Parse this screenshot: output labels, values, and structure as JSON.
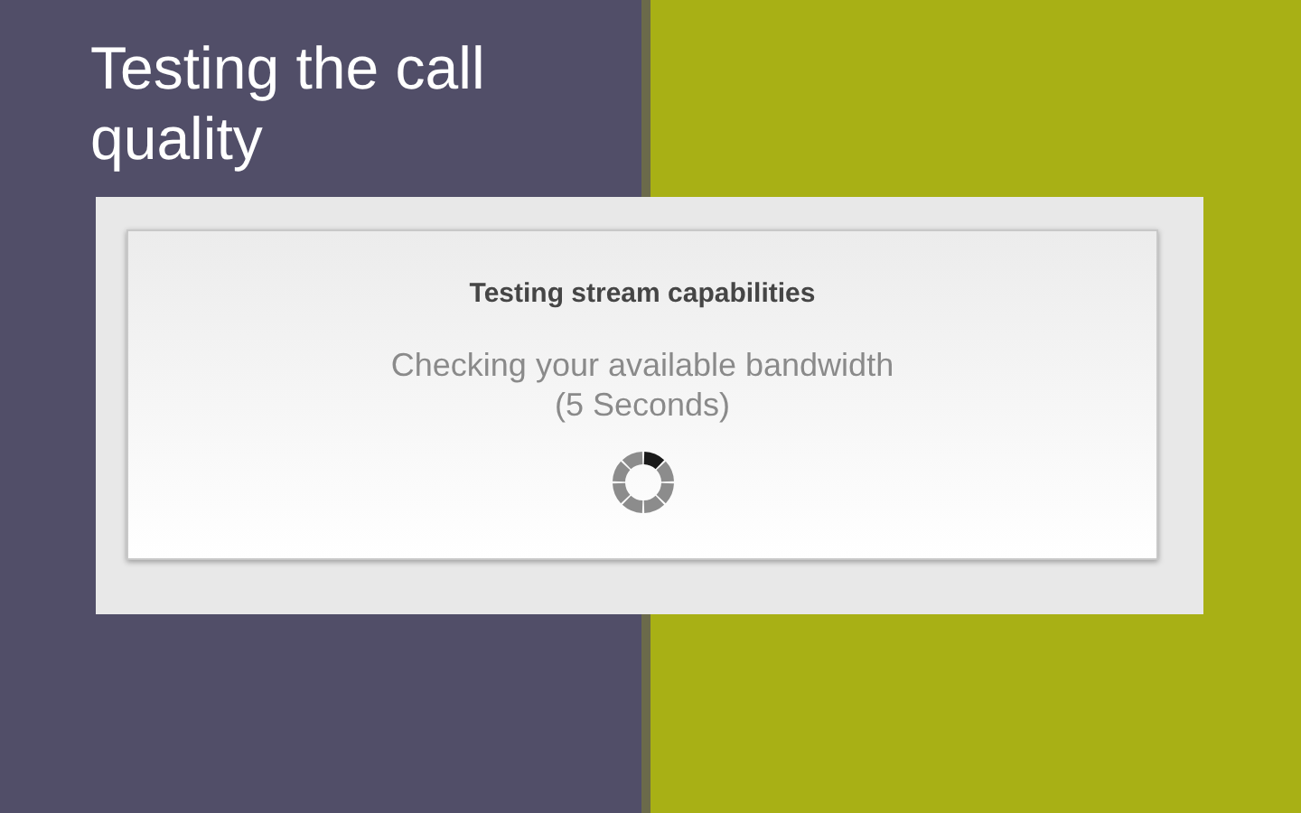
{
  "slide": {
    "title": "Testing the call quality"
  },
  "dialog": {
    "heading": "Testing stream capabilities",
    "message": "Checking your available bandwidth",
    "duration": "(5 Seconds)"
  }
}
